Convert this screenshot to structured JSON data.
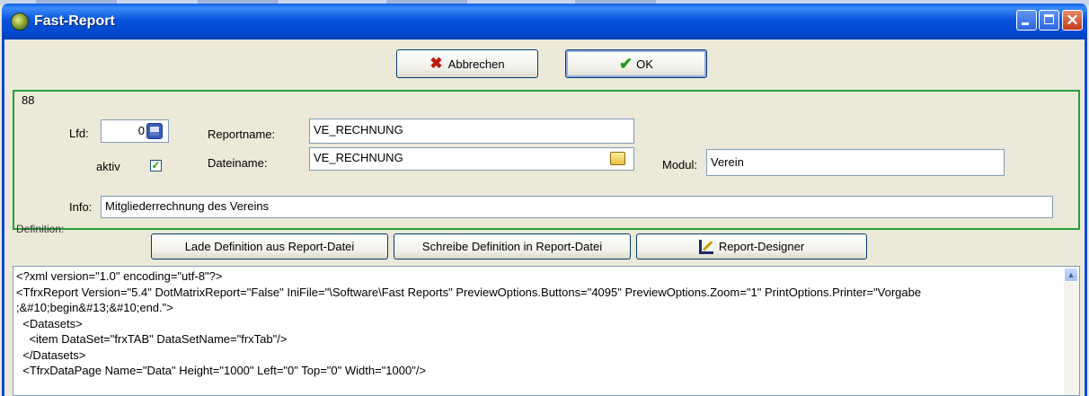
{
  "window": {
    "title": "Fast-Report"
  },
  "toolbar": {
    "cancel_label": "Abbrechen",
    "ok_label": "OK"
  },
  "form": {
    "record_id": "88",
    "lfd_label": "Lfd:",
    "lfd_value": "0",
    "reportname_label": "Reportname:",
    "reportname_value": "VE_RECHNUNG",
    "aktiv_label": "aktiv",
    "aktiv_checked": true,
    "dateiname_label": "Dateiname:",
    "dateiname_value": "VE_RECHNUNG",
    "modul_label": "Modul:",
    "modul_value": "Verein",
    "info_label": "Info:",
    "info_value": "Mitgliederrechnung des Vereins",
    "definition_label": "Definition:"
  },
  "definition_buttons": {
    "load_label": "Lade Definition aus Report-Datei",
    "write_label": "Schreibe Definition in Report-Datei",
    "designer_label": "Report-Designer"
  },
  "definition_memo": {
    "lines": [
      "<?xml version=\"1.0\" encoding=\"utf-8\"?>",
      "<TfrxReport Version=\"5.4\" DotMatrixReport=\"False\" IniFile=\"\\Software\\Fast Reports\" PreviewOptions.Buttons=\"4095\" PreviewOptions.Zoom=\"1\" PrintOptions.Printer=\"Vorgabe",
      ";&#10;begin&#13;&#10;end.\">",
      "  <Datasets>",
      "    <item DataSet=\"frxTAB\" DataSetName=\"frxTab\"/>",
      "  </Datasets>",
      "  <TfrxDataPage Name=\"Data\" Height=\"1000\" Left=\"0\" Top=\"0\" Width=\"1000\"/>"
    ]
  },
  "icons": {
    "app": "fast-report-app-icon",
    "cancel": "red-x-icon",
    "ok": "green-check-icon",
    "calculator": "calculator-icon",
    "folder": "open-folder-icon",
    "designer": "designer-icon"
  },
  "colors": {
    "titlebar": "#0054E3",
    "group_border": "#25A03A",
    "window_bg": "#ECE9D8"
  }
}
